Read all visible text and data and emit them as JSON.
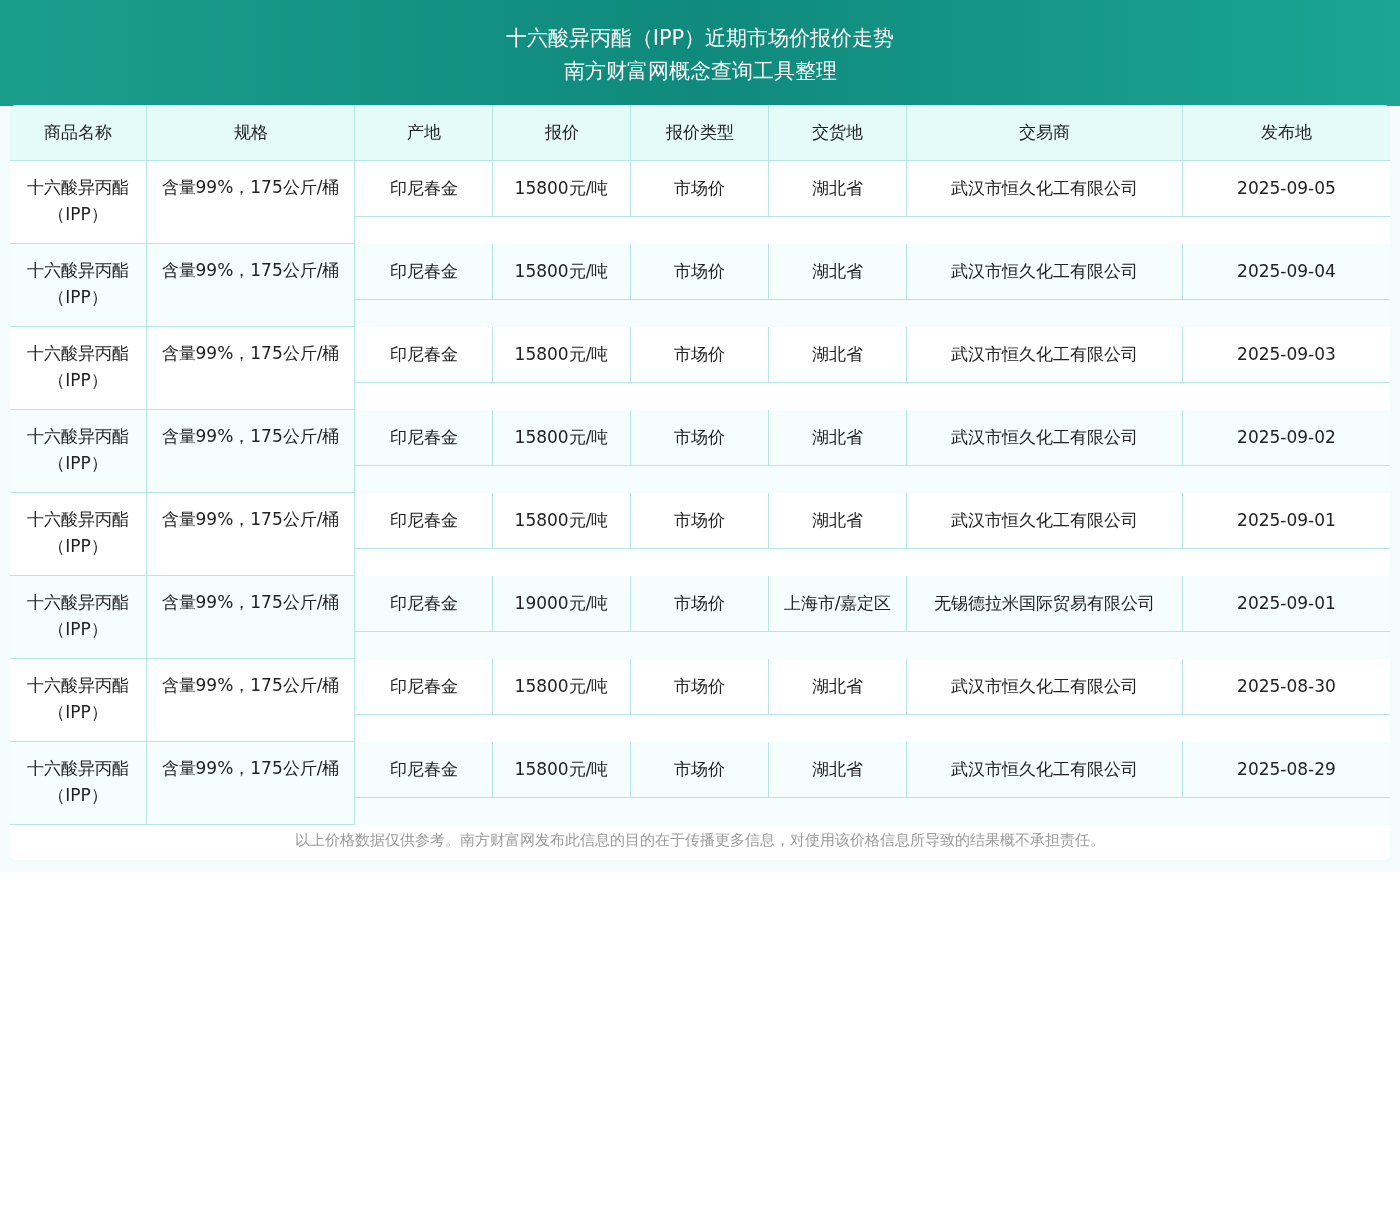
{
  "header": {
    "title": "十六酸异丙酯（IPP）近期市场价报价走势",
    "subtitle": "南方财富网概念查询工具整理"
  },
  "table": {
    "columns": [
      "商品名称",
      "规格",
      "产地",
      "报价",
      "报价类型",
      "交货地",
      "交易商",
      "发布地"
    ],
    "rows": [
      {
        "cells": [
          "十六酸异丙酯（IPP）",
          "含量99%，175公斤/桶",
          "印尼春金",
          "15800元/吨",
          "市场价",
          "湖北省",
          "武汉市恒久化工有限公司",
          "2025-09-05"
        ]
      },
      {
        "cells": [
          "十六酸异丙酯（IPP）",
          "含量99%，175公斤/桶",
          "印尼春金",
          "15800元/吨",
          "市场价",
          "湖北省",
          "武汉市恒久化工有限公司",
          "2025-09-04"
        ]
      },
      {
        "cells": [
          "十六酸异丙酯（IPP）",
          "含量99%，175公斤/桶",
          "印尼春金",
          "15800元/吨",
          "市场价",
          "湖北省",
          "武汉市恒久化工有限公司",
          "2025-09-03"
        ]
      },
      {
        "cells": [
          "十六酸异丙酯（IPP）",
          "含量99%，175公斤/桶",
          "印尼春金",
          "15800元/吨",
          "市场价",
          "湖北省",
          "武汉市恒久化工有限公司",
          "2025-09-02"
        ]
      },
      {
        "cells": [
          "十六酸异丙酯（IPP）",
          "含量99%，175公斤/桶",
          "印尼春金",
          "15800元/吨",
          "市场价",
          "湖北省",
          "武汉市恒久化工有限公司",
          "2025-09-01"
        ]
      },
      {
        "cells": [
          "十六酸异丙酯（IPP）",
          "含量99%，175公斤/桶",
          "印尼春金",
          "19000元/吨",
          "市场价",
          "上海市/嘉定区",
          "无锡德拉米国际贸易有限公司",
          "2025-09-01"
        ]
      },
      {
        "cells": [
          "十六酸异丙酯（IPP）",
          "含量99%，175公斤/桶",
          "印尼春金",
          "15800元/吨",
          "市场价",
          "湖北省",
          "武汉市恒久化工有限公司",
          "2025-08-30"
        ]
      },
      {
        "cells": [
          "十六酸异丙酯（IPP）",
          "含量99%，175公斤/桶",
          "印尼春金",
          "15800元/吨",
          "市场价",
          "湖北省",
          "武汉市恒久化工有限公司",
          "2025-08-29"
        ]
      }
    ]
  },
  "disclaimer": "以上价格数据仅供参考。南方财富网发布此信息的目的在于传播更多信息，对使用该价格信息所导致的结果概不承担责任。"
}
